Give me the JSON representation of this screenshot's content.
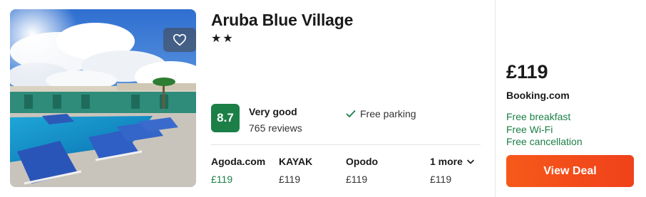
{
  "hotel": {
    "name": "Aruba Blue Village",
    "stars": "★★",
    "star_count": 2
  },
  "rating": {
    "score": "8.7",
    "label": "Very good",
    "reviews": "765 reviews"
  },
  "amenity": {
    "label": "Free parking",
    "icon": "checkmark-icon"
  },
  "providers": [
    {
      "name": "Agoda.com",
      "price": "£119"
    },
    {
      "name": "KAYAK",
      "price": "£119"
    },
    {
      "name": "Opodo",
      "price": "£119"
    },
    {
      "name": "1 more",
      "price": "£119"
    }
  ],
  "best_deal": {
    "price": "£119",
    "provider": "Booking.com",
    "perks": [
      "Free breakfast",
      "Free Wi-Fi",
      "Free cancellation"
    ],
    "button_label": "View Deal"
  },
  "colors": {
    "score_badge": "#1b7f47",
    "perk_text": "#1b7f47",
    "provider_price": "#1b7f47",
    "button": "#f4511b"
  },
  "icons": {
    "favorite": "heart-outline-icon",
    "expand": "chevron-down-icon"
  }
}
